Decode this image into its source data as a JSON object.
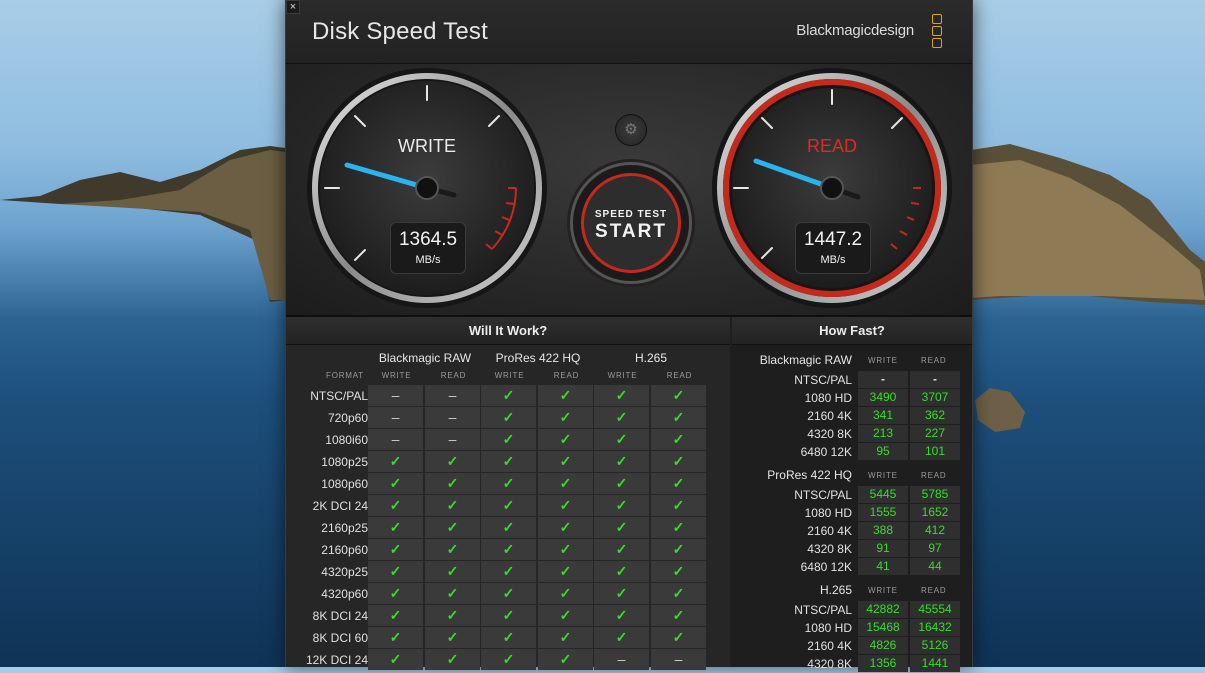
{
  "window": {
    "title": "Disk Speed Test",
    "brand": "Blackmagicdesign",
    "close_glyph": "×"
  },
  "gauges": {
    "write": {
      "label": "WRITE",
      "value": "1364.5",
      "unit": "MB/s"
    },
    "read": {
      "label": "READ",
      "value": "1447.2",
      "unit": "MB/s"
    },
    "start_small": "SPEED TEST",
    "start_big": "START",
    "gear_glyph": "⚙"
  },
  "will_it_work": {
    "heading": "Will It Work?",
    "format_label": "FORMAT",
    "groups": [
      "Blackmagic RAW",
      "ProRes 422 HQ",
      "H.265"
    ],
    "col_write": "WRITE",
    "col_read": "READ",
    "ok": "✓",
    "na": "–",
    "rows": [
      {
        "format": "NTSC/PAL",
        "marks": [
          "na",
          "na",
          "ok",
          "ok",
          "ok",
          "ok"
        ]
      },
      {
        "format": "720p60",
        "marks": [
          "na",
          "na",
          "ok",
          "ok",
          "ok",
          "ok"
        ]
      },
      {
        "format": "1080i60",
        "marks": [
          "na",
          "na",
          "ok",
          "ok",
          "ok",
          "ok"
        ]
      },
      {
        "format": "1080p25",
        "marks": [
          "ok",
          "ok",
          "ok",
          "ok",
          "ok",
          "ok"
        ]
      },
      {
        "format": "1080p60",
        "marks": [
          "ok",
          "ok",
          "ok",
          "ok",
          "ok",
          "ok"
        ]
      },
      {
        "format": "2K DCI 24",
        "marks": [
          "ok",
          "ok",
          "ok",
          "ok",
          "ok",
          "ok"
        ]
      },
      {
        "format": "2160p25",
        "marks": [
          "ok",
          "ok",
          "ok",
          "ok",
          "ok",
          "ok"
        ]
      },
      {
        "format": "2160p60",
        "marks": [
          "ok",
          "ok",
          "ok",
          "ok",
          "ok",
          "ok"
        ]
      },
      {
        "format": "4320p25",
        "marks": [
          "ok",
          "ok",
          "ok",
          "ok",
          "ok",
          "ok"
        ]
      },
      {
        "format": "4320p60",
        "marks": [
          "ok",
          "ok",
          "ok",
          "ok",
          "ok",
          "ok"
        ]
      },
      {
        "format": "8K DCI 24",
        "marks": [
          "ok",
          "ok",
          "ok",
          "ok",
          "ok",
          "ok"
        ]
      },
      {
        "format": "8K DCI 60",
        "marks": [
          "ok",
          "ok",
          "ok",
          "ok",
          "ok",
          "ok"
        ]
      },
      {
        "format": "12K DCI 24",
        "marks": [
          "ok",
          "ok",
          "ok",
          "ok",
          "na",
          "na"
        ]
      }
    ]
  },
  "how_fast": {
    "heading": "How Fast?",
    "col_write": "WRITE",
    "col_read": "READ",
    "groups": [
      {
        "name": "Blackmagic RAW",
        "rows": [
          {
            "format": "NTSC/PAL",
            "write": "-",
            "read": "-"
          },
          {
            "format": "1080 HD",
            "write": "3490",
            "read": "3707"
          },
          {
            "format": "2160 4K",
            "write": "341",
            "read": "362"
          },
          {
            "format": "4320 8K",
            "write": "213",
            "read": "227"
          },
          {
            "format": "6480 12K",
            "write": "95",
            "read": "101"
          }
        ]
      },
      {
        "name": "ProRes 422 HQ",
        "rows": [
          {
            "format": "NTSC/PAL",
            "write": "5445",
            "read": "5785"
          },
          {
            "format": "1080 HD",
            "write": "1555",
            "read": "1652"
          },
          {
            "format": "2160 4K",
            "write": "388",
            "read": "412"
          },
          {
            "format": "4320 8K",
            "write": "91",
            "read": "97"
          },
          {
            "format": "6480 12K",
            "write": "41",
            "read": "44"
          }
        ]
      },
      {
        "name": "H.265",
        "rows": [
          {
            "format": "NTSC/PAL",
            "write": "42882",
            "read": "45554"
          },
          {
            "format": "1080 HD",
            "write": "15468",
            "read": "16432"
          },
          {
            "format": "2160 4K",
            "write": "4826",
            "read": "5126"
          },
          {
            "format": "4320 8K",
            "write": "1356",
            "read": "1441"
          }
        ]
      }
    ]
  },
  "colors": {
    "accent_red": "#c42a1b",
    "needle_blue": "#2ab3ec",
    "check_green": "#3adb2e"
  }
}
